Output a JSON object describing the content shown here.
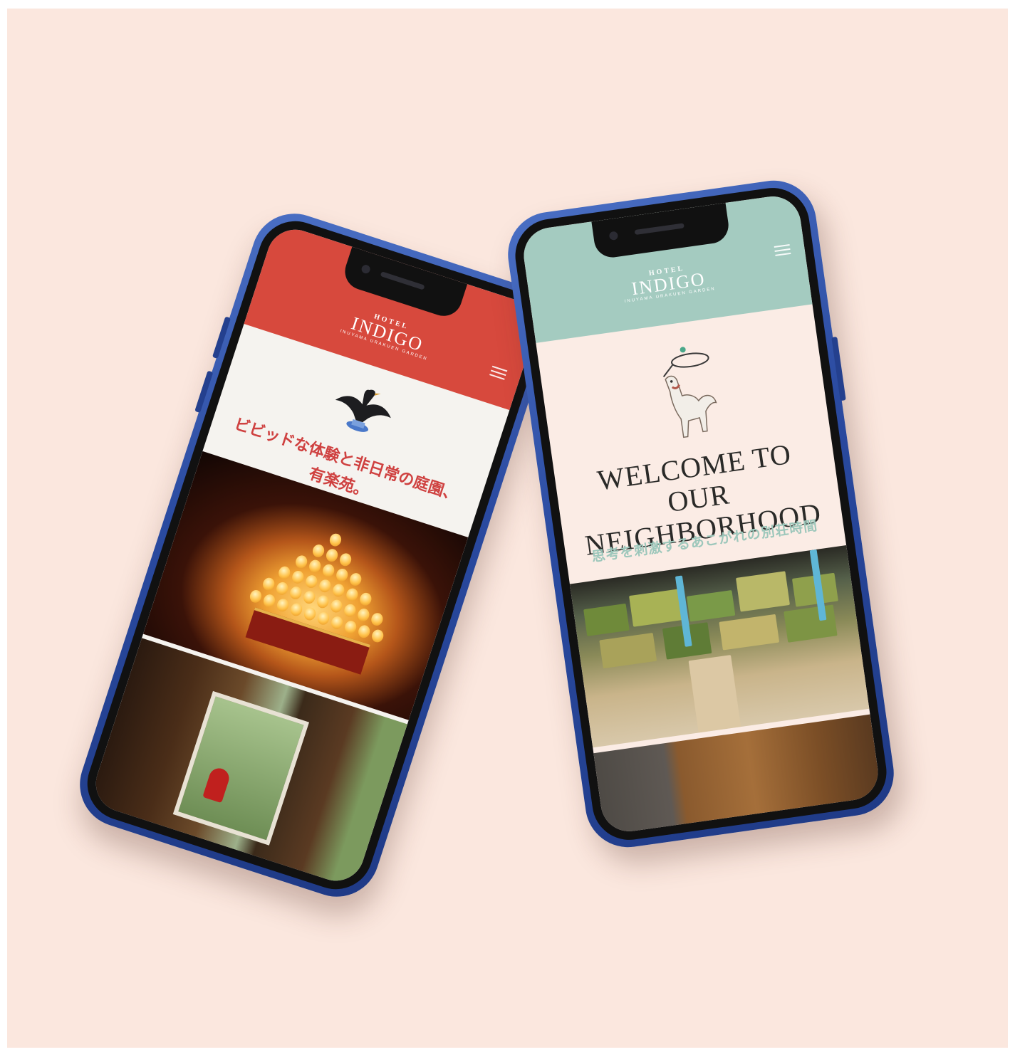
{
  "background": "#fbe7de",
  "phone_left": {
    "header_color": "#d7493d",
    "logo": {
      "top": "HOTEL",
      "main": "INDIGO",
      "sub": "INUYAMA URAKUEN GARDEN"
    },
    "menu_icon": "hamburger-icon",
    "hero_lines": [
      "ビビッドな体験と非日常の庭園、",
      "有楽苑。"
    ],
    "images": [
      "festival-lanterns-photo",
      "temple-garden-photo"
    ]
  },
  "phone_right": {
    "header_color": "#a4cbc0",
    "logo": {
      "top": "HOTEL",
      "main": "INDIGO",
      "sub": "INUYAMA URAKUEN GARDEN"
    },
    "menu_icon": "hamburger-icon",
    "heading_lines": [
      "WELCOME TO OUR",
      "NEIGHBORHOOD"
    ],
    "subheading": "思考を刺激するあこがれの別荘時間",
    "accent_color": "#9dc7bb",
    "images": [
      "lounge-interior-photo",
      "wood-furniture-photo"
    ]
  }
}
